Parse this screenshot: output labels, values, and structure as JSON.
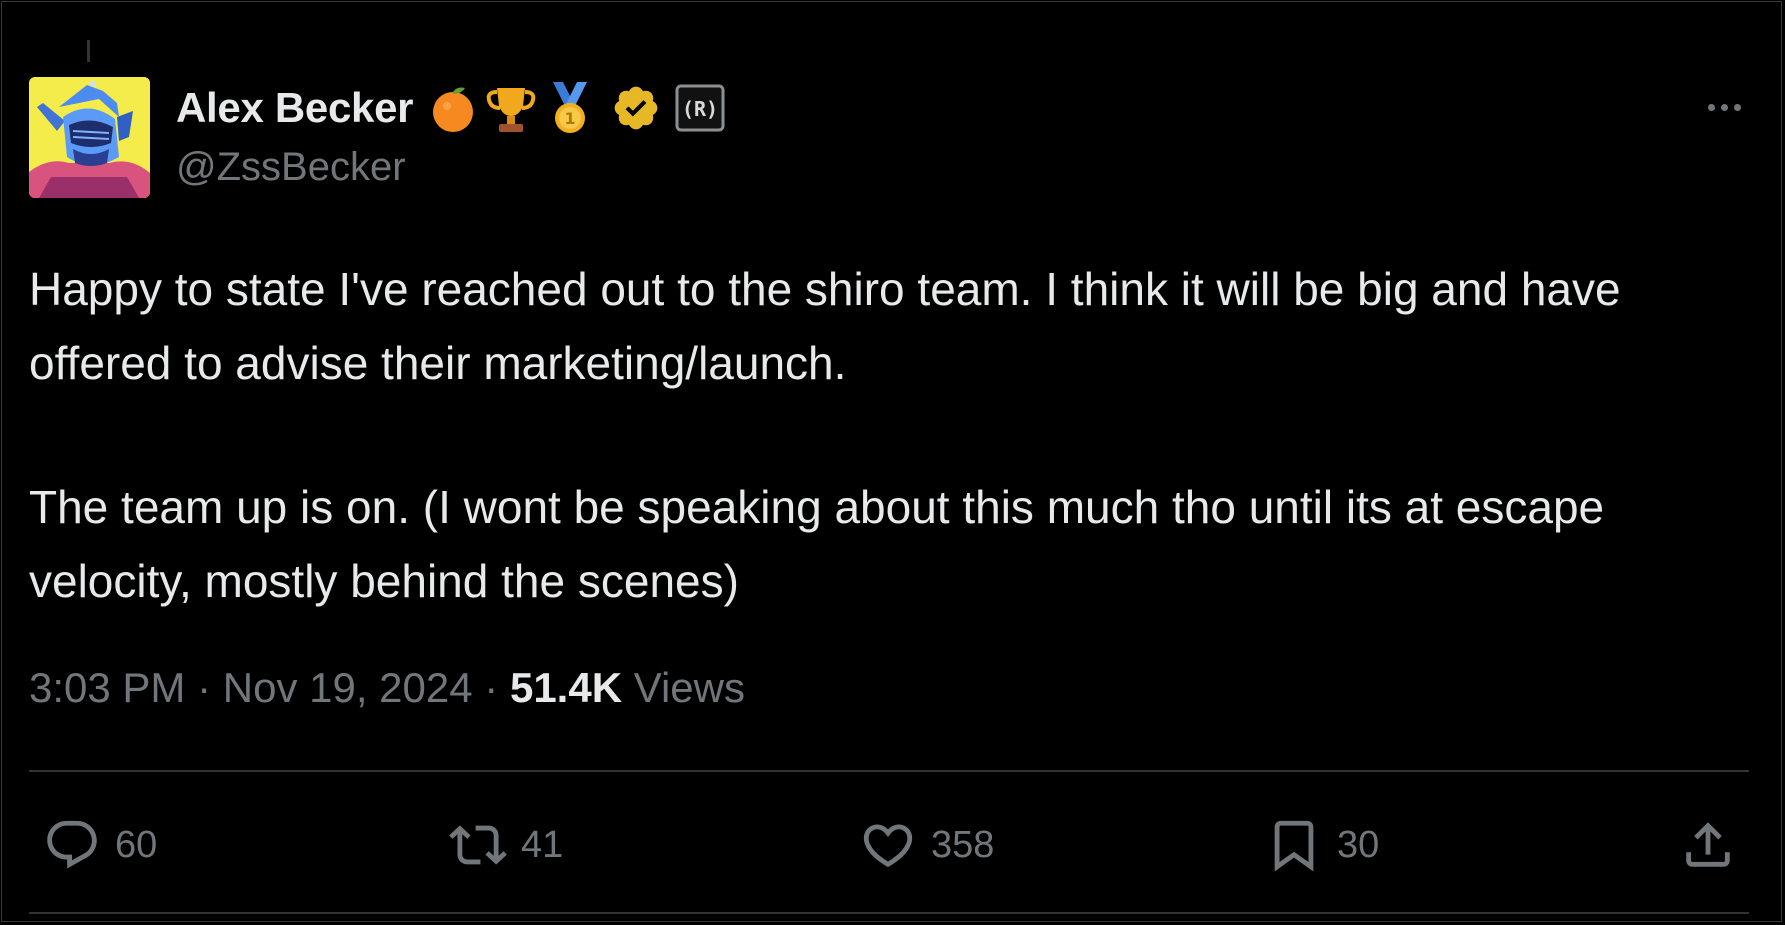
{
  "tweet": {
    "author": {
      "display_name": "Alex Becker",
      "handle": "@ZssBecker",
      "badges": [
        "orange-emoji",
        "trophy-emoji",
        "first-place-medal-emoji",
        "verified-badge-icon",
        "affiliate-badge-icon"
      ]
    },
    "text": [
      "Happy to state I've reached out to the shiro team. I think it will be big and have offered to advise their marketing/launch.",
      "The team up is on. (I wont be speaking about this much tho until its at escape velocity, mostly behind the scenes)"
    ],
    "time": "3:03 PM",
    "separator": "·",
    "date": "Nov 19, 2024",
    "views_count": "51.4K",
    "views_label": "Views",
    "actions": {
      "replies": "60",
      "retweets": "41",
      "likes": "358",
      "bookmarks": "30"
    }
  },
  "colors": {
    "background": "#000000",
    "text_primary": "#e7e9ea",
    "text_secondary": "#71767b",
    "divider": "#2f3336",
    "verified_gold": "#e6b825"
  }
}
